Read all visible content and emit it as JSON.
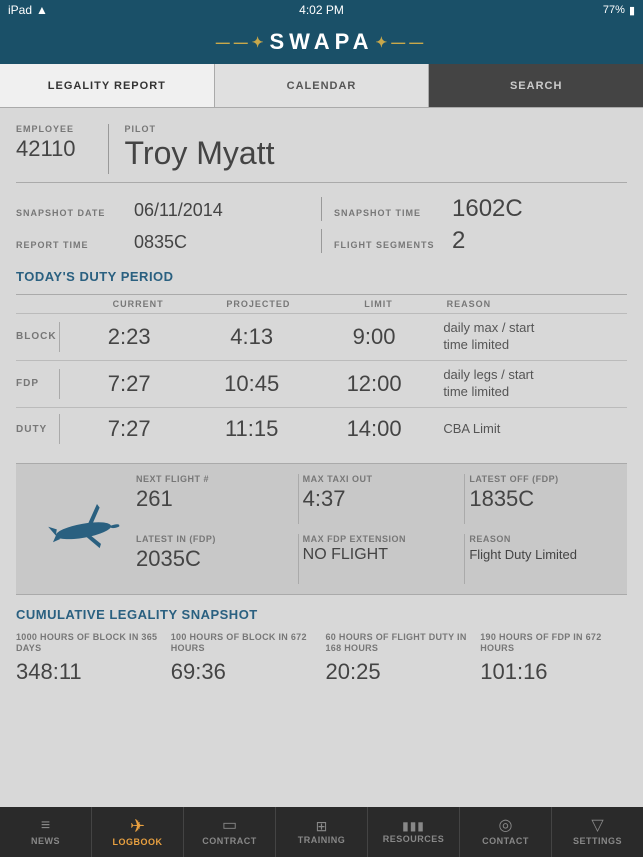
{
  "statusBar": {
    "device": "iPad",
    "time": "4:02 PM",
    "battery": "77%"
  },
  "logo": {
    "text": "SWAPA"
  },
  "tabs": [
    {
      "id": "legality",
      "label": "LEGALITY REPORT",
      "active": true
    },
    {
      "id": "calendar",
      "label": "CALENDAR",
      "active": false
    },
    {
      "id": "search",
      "label": "SEARCH",
      "active": false
    }
  ],
  "employee": {
    "idLabel": "EMPLOYEE",
    "id": "42110",
    "pilotLabel": "PILOT",
    "name": "Troy Myatt"
  },
  "snapshotDate": {
    "label": "SNAPSHOT DATE",
    "value": "06/11/2014"
  },
  "snapshotTime": {
    "label": "SNAPSHOT TIME",
    "value": "1602C"
  },
  "reportTime": {
    "label": "REPORT TIME",
    "value": "0835C"
  },
  "flightSegments": {
    "label": "FLIGHT SEGMENTS",
    "value": "2"
  },
  "dutyPeriodTitle": "TODAY'S DUTY PERIOD",
  "dutyHeaders": {
    "current": "CURRENT",
    "projected": "PROJECTED",
    "limit": "LIMIT",
    "reason": "REASON"
  },
  "dutyRows": [
    {
      "type": "BLOCK",
      "current": "2:23",
      "projected": "4:13",
      "limit": "9:00",
      "reason": "daily max / start\ntime limited"
    },
    {
      "type": "FDP",
      "current": "7:27",
      "projected": "10:45",
      "limit": "12:00",
      "reason": "daily legs / start\ntime limited"
    },
    {
      "type": "DUTY",
      "current": "7:27",
      "projected": "11:15",
      "limit": "14:00",
      "reason": "CBA Limit"
    }
  ],
  "flightInfo": {
    "nextFlightLabel": "NEXT FLIGHT #",
    "nextFlight": "261",
    "maxTaxiOutLabel": "MAX TAXI OUT",
    "maxTaxiOut": "4:37",
    "latestOffLabel": "LATEST OFF (FDP)",
    "latestOff": "1835C",
    "latestInLabel": "LATEST IN (FDP)",
    "latestIn": "2035C",
    "maxFdpExtLabel": "MAX FDP EXTENSION",
    "maxFdpExt": "NO FLIGHT",
    "reasonLabel": "REASON",
    "reason": "Flight Duty Limited"
  },
  "cumulativeTitle": "CUMULATIVE LEGALITY SNAPSHOT",
  "cumulativeItems": [
    {
      "label": "1000 HOURS OF BLOCK IN 365 DAYS",
      "value": "348:11"
    },
    {
      "label": "100 HOURS OF BLOCK IN 672 HOURS",
      "value": "69:36"
    },
    {
      "label": "60 HOURS OF FLIGHT DUTY IN 168 HOURS",
      "value": "20:25"
    },
    {
      "label": "190 HOURS OF FDP IN 672 HOURS",
      "value": "101:16"
    }
  ],
  "bottomNav": [
    {
      "id": "news",
      "label": "NEWS",
      "icon": "≡",
      "active": false
    },
    {
      "id": "logbook",
      "label": "LOGBOOK",
      "icon": "✈",
      "active": true
    },
    {
      "id": "contract",
      "label": "CONTRACT",
      "icon": "▭",
      "active": false
    },
    {
      "id": "training",
      "label": "TRAINING",
      "icon": "⊞",
      "active": false
    },
    {
      "id": "resources",
      "label": "RESOURCES",
      "icon": "▮▮▮",
      "active": false
    },
    {
      "id": "contact",
      "label": "CONTACT",
      "icon": "◎",
      "active": false
    },
    {
      "id": "settings",
      "label": "SETTINGS",
      "icon": "▽",
      "active": false
    }
  ]
}
